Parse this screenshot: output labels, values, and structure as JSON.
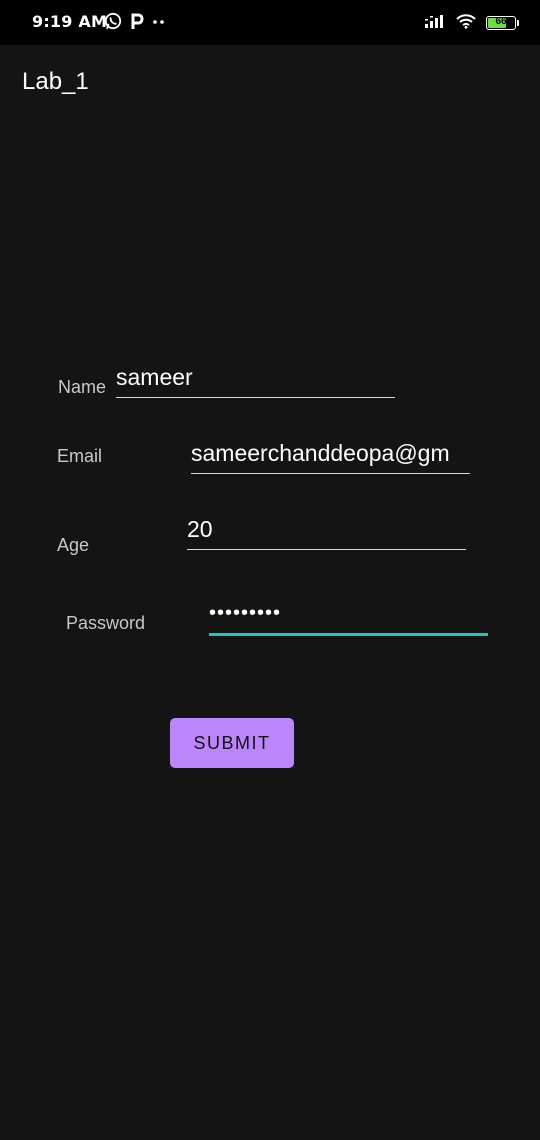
{
  "status_bar": {
    "time": "9:19 AM",
    "battery_level": "66",
    "icons": [
      "whatsapp-icon",
      "p-app-icon",
      "more-notifications-icon",
      "signal-icon",
      "wifi-icon",
      "battery-icon"
    ]
  },
  "app_bar": {
    "title": "Lab_1"
  },
  "form": {
    "name_label": "Name",
    "name_value": "sameer",
    "email_label": "Email",
    "email_value": "sameerchanddeopa@gm",
    "age_label": "Age",
    "age_value": "20",
    "password_label": "Password",
    "password_value": "•••••••••",
    "submit_label": "SUBMIT"
  },
  "colors": {
    "background": "#141414",
    "status_bar": "#000000",
    "accent_focus": "#1fc6be",
    "button": "#bb86fc",
    "battery": "#6ddf3c"
  }
}
